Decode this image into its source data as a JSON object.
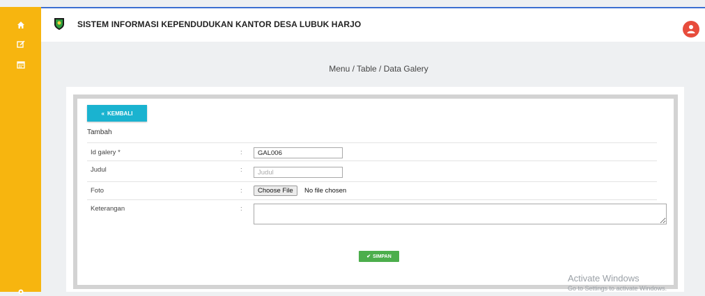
{
  "header": {
    "title": "SISTEM INFORMASI KEPENDUDUKAN KANTOR DESA LUBUK HARJO"
  },
  "sidebar": {
    "items": [
      {
        "icon": "home-icon"
      },
      {
        "icon": "edit-icon"
      },
      {
        "icon": "calendar-icon"
      },
      {
        "icon": "settings-icon"
      }
    ]
  },
  "breadcrumb": "Menu / Table / Data Galery",
  "form": {
    "back_label": "KEMBALI",
    "section_title": "Tambah",
    "fields": {
      "id_galery": {
        "label": "Id galery *",
        "value": "GAL006"
      },
      "judul": {
        "label": "Judul",
        "placeholder": "Judul"
      },
      "foto": {
        "label": "Foto",
        "button": "Choose File",
        "status": "No file chosen"
      },
      "keterangan": {
        "label": "Keterangan"
      }
    },
    "colon": ":",
    "save_label": "SIMPAN"
  },
  "watermark": {
    "line1": "Activate Windows",
    "line2": "Go to Settings to activate Windows."
  },
  "colors": {
    "sidebar": "#f7b50f",
    "back_button": "#1ab3d0",
    "save_button": "#4cae4c",
    "avatar": "#e74c3c"
  }
}
